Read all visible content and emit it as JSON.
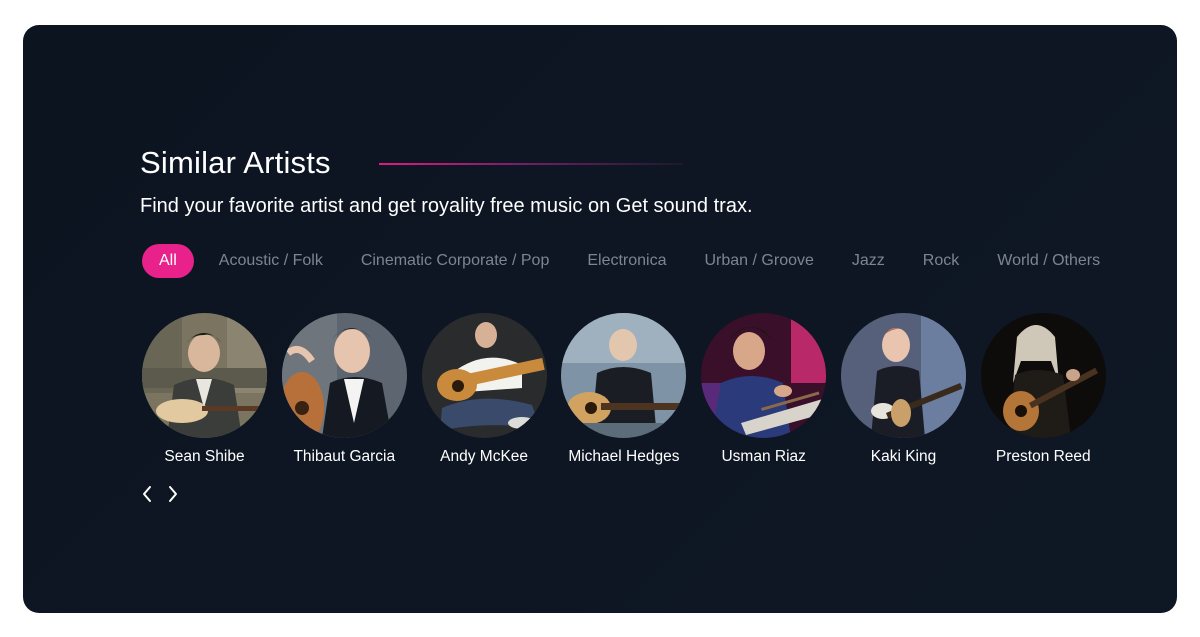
{
  "section": {
    "title": "Similar Artists",
    "subtitle": "Find your favorite artist and get royality free music on Get sound trax."
  },
  "filters": {
    "tabs": [
      {
        "label": "All",
        "active": true
      },
      {
        "label": "Acoustic / Folk",
        "active": false
      },
      {
        "label": "Cinematic Corporate / Pop",
        "active": false
      },
      {
        "label": "Electronica",
        "active": false
      },
      {
        "label": "Urban / Groove",
        "active": false
      },
      {
        "label": "Jazz",
        "active": false
      },
      {
        "label": "Rock",
        "active": false
      },
      {
        "label": "World / Others",
        "active": false
      }
    ]
  },
  "artists": [
    {
      "name": "Sean Shibe"
    },
    {
      "name": "Thibaut Garcia"
    },
    {
      "name": "Andy McKee"
    },
    {
      "name": "Michael Hedges"
    },
    {
      "name": "Usman Riaz"
    },
    {
      "name": "Kaki King"
    },
    {
      "name": "Preston Reed"
    }
  ],
  "carousel": {
    "prev_icon": "chevron-left-icon",
    "next_icon": "chevron-right-icon"
  },
  "colors": {
    "card_background": "#0d1622",
    "accent": "#e8228a",
    "tab_inactive_text": "#7d8590",
    "text_primary": "#ffffff"
  }
}
